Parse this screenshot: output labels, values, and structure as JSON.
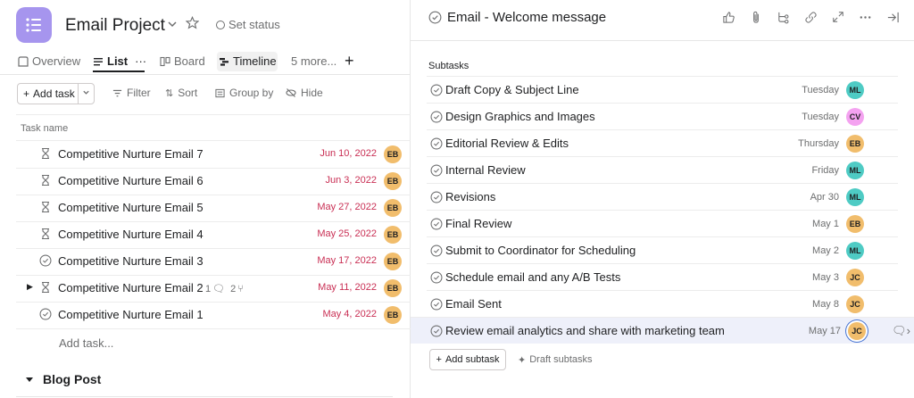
{
  "project": {
    "title": "Email Project",
    "set_status": "Set status"
  },
  "tabs": [
    {
      "label": "Overview"
    },
    {
      "label": "List",
      "more": "···"
    },
    {
      "label": "Board"
    },
    {
      "label": "Timeline"
    },
    {
      "label": "5 more..."
    }
  ],
  "toolbar": {
    "add_task": "Add task",
    "filter": "Filter",
    "sort": "Sort",
    "group_by": "Group by",
    "hide": "Hide"
  },
  "table": {
    "col_task_name": "Task name"
  },
  "tasks": [
    {
      "name": "Competitive Nurture Email 7",
      "due": "Jun 10, 2022",
      "assignee": "EB",
      "status": "waiting"
    },
    {
      "name": "Competitive Nurture Email 6",
      "due": "Jun 3, 2022",
      "assignee": "EB",
      "status": "waiting"
    },
    {
      "name": "Competitive Nurture Email 5",
      "due": "May 27, 2022",
      "assignee": "EB",
      "status": "waiting"
    },
    {
      "name": "Competitive Nurture Email 4",
      "due": "May 25, 2022",
      "assignee": "EB",
      "status": "waiting"
    },
    {
      "name": "Competitive Nurture Email 3",
      "due": "May 17, 2022",
      "assignee": "EB",
      "status": "check"
    },
    {
      "name": "Competitive Nurture Email 2",
      "due": "May 11, 2022",
      "assignee": "EB",
      "status": "waiting",
      "comments": "1",
      "subtasks": "2"
    },
    {
      "name": "Competitive Nurture Email 1",
      "due": "May 4, 2022",
      "assignee": "EB",
      "status": "check"
    }
  ],
  "add_task_link": "Add task...",
  "section": {
    "title": "Blog Post"
  },
  "detail": {
    "title": "Email - Welcome message",
    "subtasks_label": "Subtasks",
    "subtasks": [
      {
        "name": "Draft Copy & Subject Line",
        "due": "Tuesday",
        "assignee": "ML"
      },
      {
        "name": "Design Graphics and Images",
        "due": "Tuesday",
        "assignee": "CV"
      },
      {
        "name": "Editorial Review & Edits",
        "due": "Thursday",
        "assignee": "EB"
      },
      {
        "name": "Internal Review",
        "due": "Friday",
        "assignee": "ML"
      },
      {
        "name": "Revisions",
        "due": "Apr 30",
        "assignee": "ML"
      },
      {
        "name": "Final Review",
        "due": "May 1",
        "assignee": "EB"
      },
      {
        "name": "Submit to Coordinator for Scheduling",
        "due": "May 2",
        "assignee": "ML"
      },
      {
        "name": "Schedule email and any A/B Tests",
        "due": "May 3",
        "assignee": "JC"
      },
      {
        "name": "Email Sent",
        "due": "May 8",
        "assignee": "JC"
      },
      {
        "name": "Review email analytics and share with marketing team",
        "due": "May 17",
        "assignee": "JC"
      }
    ],
    "add_subtask": "Add subtask",
    "draft_subtasks": "Draft subtasks"
  },
  "colors": {
    "accent": "#a695ee",
    "overdue": "#c92f54",
    "avatar_EB": "#f1bd6c",
    "avatar_ML": "#4ecbc4",
    "avatar_CV": "#f4a2f0",
    "avatar_JC": "#f1bd6c",
    "highlight_row": "#eef0fa"
  }
}
